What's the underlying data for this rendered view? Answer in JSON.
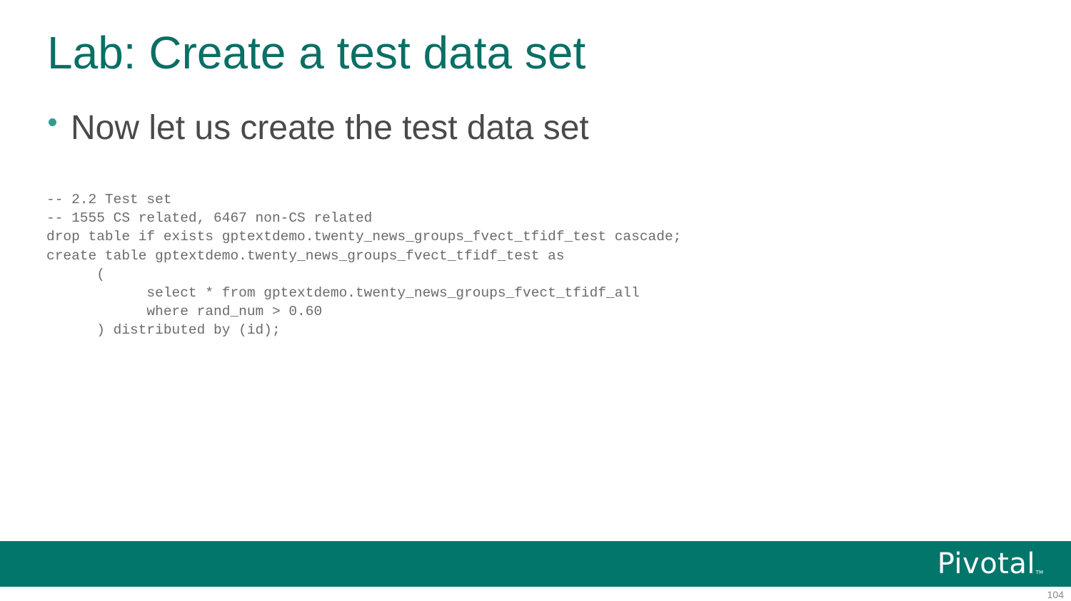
{
  "slide": {
    "title": "Lab: Create a test data set",
    "bullet": "Now let us create the test data set",
    "code_lines": [
      "-- 2.2 Test set",
      "-- 1555 CS related, 6467 non-CS related",
      "drop table if exists gptextdemo.twenty_news_groups_fvect_tfidf_test cascade;",
      "create table gptextdemo.twenty_news_groups_fvect_tfidf_test as",
      "      (",
      "            select * from gptextdemo.twenty_news_groups_fvect_tfidf_all",
      "            where rand_num > 0.60",
      "      ) distributed by (id);"
    ]
  },
  "footer": {
    "logo_text": "Pivotal",
    "logo_tm": "TM",
    "page_number": "104"
  },
  "colors": {
    "title": "#0a6f65",
    "bullet_dot": "#2f9e92",
    "footer_bar": "#03766c",
    "code_text": "#6b6b6b",
    "body_text": "#4a4a4a"
  }
}
